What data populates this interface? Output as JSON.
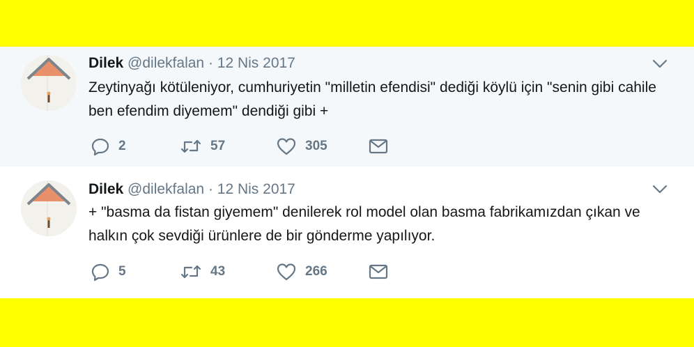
{
  "colors": {
    "band": "#fffe00",
    "tweet1_bg": "#f5f8fa",
    "tweet2_bg": "#ffffff",
    "text": "#14171a",
    "meta": "#657786"
  },
  "tweets": [
    {
      "name": "Dilek",
      "handle": "@dilekfalan",
      "separator": "·",
      "date": "12 Nis 2017",
      "text": "Zeytinyağı kötüleniyor, cumhuriyetin \"milletin efendisi\" dediği köylü için \"senin gibi cahile ben efendim diyemem\" dendiği gibi +",
      "replies": "2",
      "retweets": "57",
      "likes": "305",
      "icons": [
        "reply-icon",
        "retweet-icon",
        "heart-icon",
        "envelope-icon",
        "chevron-down-icon"
      ]
    },
    {
      "name": "Dilek",
      "handle": "@dilekfalan",
      "separator": "·",
      "date": "12 Nis 2017",
      "text": "+ \"basma da fistan giyemem\" denilerek rol model olan basma fabrikamızdan çıkan ve halkın çok sevdiği ürünlere de bir gönderme yapılıyor.",
      "replies": "5",
      "retweets": "43",
      "likes": "266",
      "icons": [
        "reply-icon",
        "retweet-icon",
        "heart-icon",
        "envelope-icon",
        "chevron-down-icon"
      ]
    }
  ]
}
